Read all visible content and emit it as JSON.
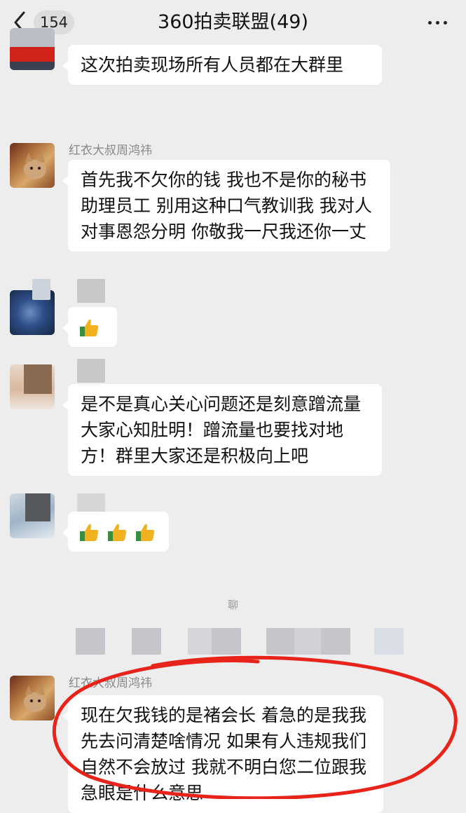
{
  "header": {
    "back_count": "154",
    "title": "360拍卖联盟(49)"
  },
  "messages": [
    {
      "sender": "",
      "text": "这次拍卖现场所有人员都在大群里"
    },
    {
      "sender": "红衣大叔周鸿祎",
      "text": "首先我不欠你的钱 我也不是你的秘书助理员工 别用这种口气教训我 我对人对事恩怨分明 你敬我一尺我还你一丈"
    },
    {
      "sender": "",
      "text": "👍"
    },
    {
      "sender": "",
      "text": "是不是真心关心问题还是刻意蹭流量大家心知肚明！蹭流量也要找对地方！群里大家还是积极向上吧"
    },
    {
      "sender": "",
      "text": "👍👍👍"
    },
    {
      "sender": "红衣大叔周鸿祎",
      "text": "现在欠我钱的是褚会长 着急的是我我先去问清楚啥情况 如果有人违规我们自然不会放过 我就不明白您二位跟我急眼是什么意思"
    }
  ],
  "divider_text": "聊",
  "colors": {
    "background": "#ededed",
    "bubble": "#ffffff",
    "annotation": "#e8231a"
  }
}
